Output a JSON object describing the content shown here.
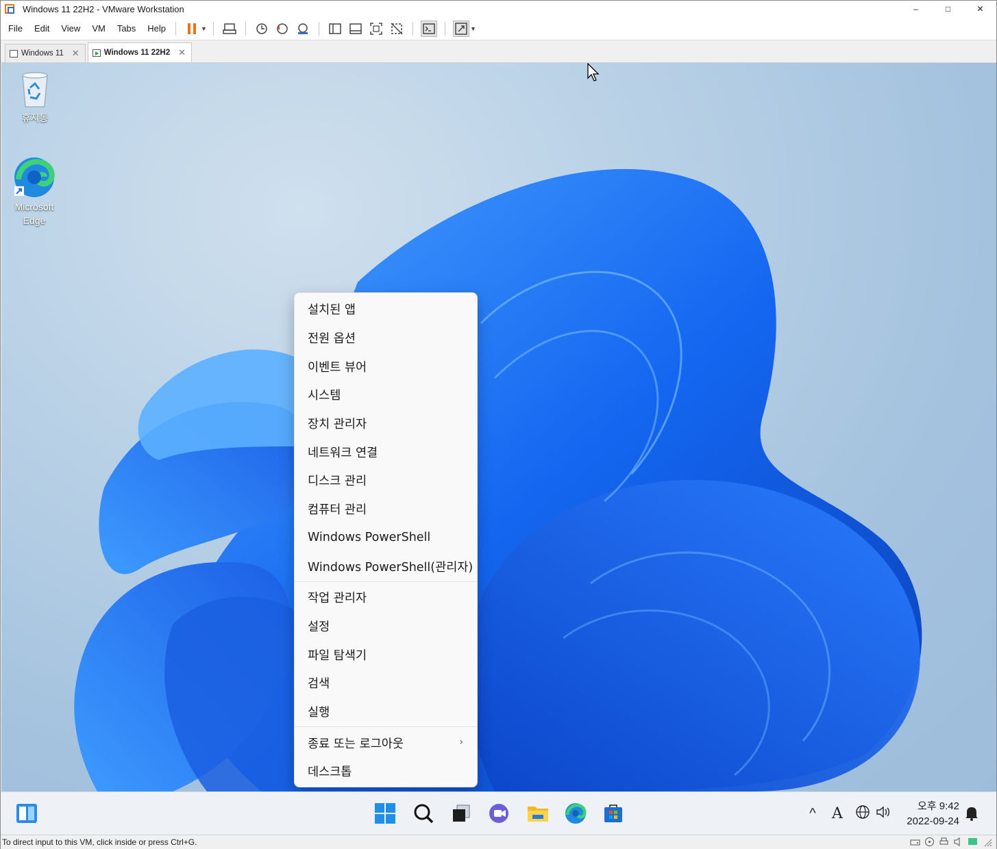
{
  "window": {
    "title": "Windows 11 22H2 - VMware Workstation",
    "minimize": "–",
    "maximize": "□",
    "close": "✕"
  },
  "menu": {
    "items": [
      "File",
      "Edit",
      "View",
      "VM",
      "Tabs",
      "Help"
    ]
  },
  "tabs": [
    {
      "label": "Windows 11",
      "close": "✕"
    },
    {
      "label": "Windows 11 22H2",
      "close": "✕"
    }
  ],
  "desktop": {
    "icons": [
      {
        "label": "휴지통",
        "icon": "recycle-bin-icon"
      },
      {
        "label": "Microsoft Edge",
        "icon": "edge-icon"
      }
    ]
  },
  "context_menu": {
    "group1": [
      "설치된 앱",
      "전원 옵션",
      "이벤트 뷰어",
      "시스템",
      "장치 관리자",
      "네트워크 연결",
      "디스크 관리",
      "컴퓨터 관리",
      "Windows PowerShell",
      "Windows PowerShell(관리자)"
    ],
    "group2": [
      "작업 관리자",
      "설정",
      "파일 탐색기",
      "검색",
      "실행"
    ],
    "group3": [
      "종료 또는 로그아웃",
      "데스크톱"
    ],
    "submenu_chevron": "›"
  },
  "taskbar": {
    "time": "오후 9:42",
    "date": "2022-09-24",
    "ime": "A",
    "chevron": "^"
  },
  "statusbar": {
    "message": "To direct input to this VM, click inside or press Ctrl+G."
  },
  "colors": {
    "accent": "#0078d4",
    "pause": "#e8731a"
  }
}
